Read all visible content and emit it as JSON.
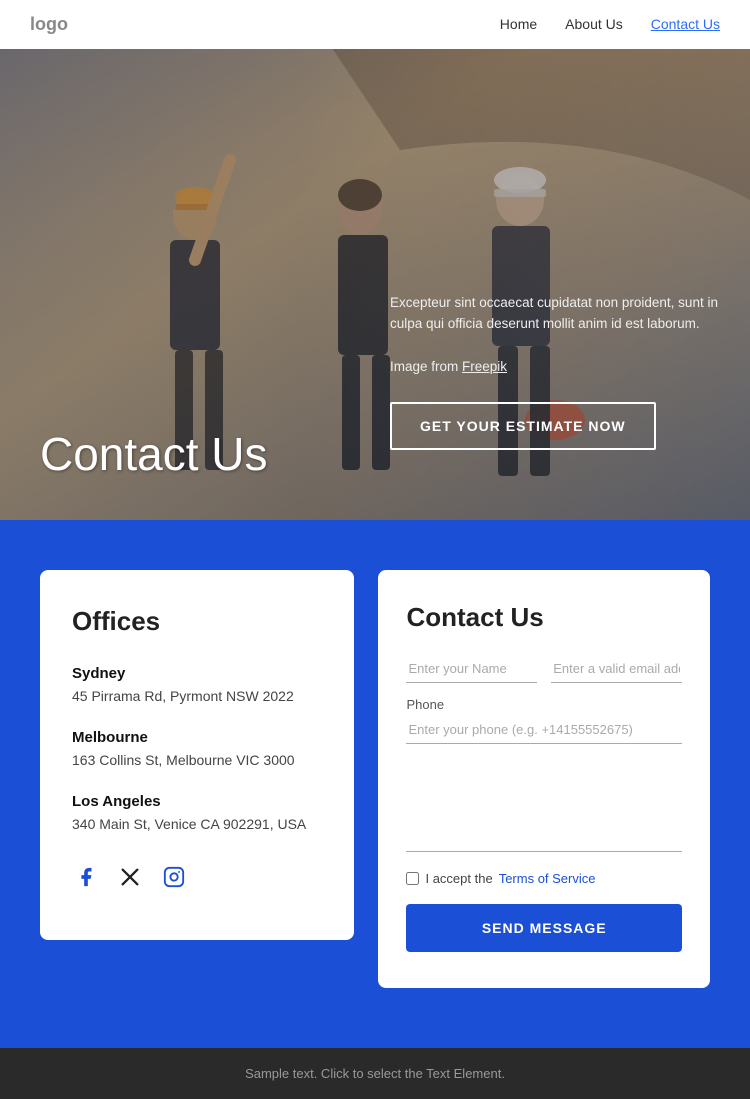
{
  "nav": {
    "logo": "logo",
    "links": [
      {
        "label": "Home",
        "active": false
      },
      {
        "label": "About Us",
        "active": false
      },
      {
        "label": "Contact Us",
        "active": true
      }
    ]
  },
  "hero": {
    "title": "Contact Us",
    "description": "Excepteur sint occaecat cupidatat non proident, sunt in culpa qui officia deserunt mollit anim id est laborum.",
    "image_credit_prefix": "Image from ",
    "image_credit_link": "Freepik",
    "cta_button": "GET YOUR ESTIMATE NOW"
  },
  "offices": {
    "title": "Offices",
    "locations": [
      {
        "city": "Sydney",
        "address": "45 Pirrama Rd, Pyrmont NSW 2022"
      },
      {
        "city": "Melbourne",
        "address": "163 Collins St, Melbourne VIC 3000"
      },
      {
        "city": "Los Angeles",
        "address": "340 Main St, Venice CA 902291, USA"
      }
    ],
    "social": [
      {
        "name": "facebook",
        "label": "Facebook"
      },
      {
        "name": "twitter-x",
        "label": "X (Twitter)"
      },
      {
        "name": "instagram",
        "label": "Instagram"
      }
    ]
  },
  "contact_form": {
    "title": "Contact Us",
    "name_placeholder": "Enter your Name",
    "email_placeholder": "Enter a valid email address",
    "phone_label": "Phone",
    "phone_placeholder": "Enter your phone (e.g. +14155552675)",
    "terms_text": "I accept the ",
    "terms_link": "Terms of Service",
    "send_button": "SEND MESSAGE"
  },
  "footer": {
    "text": "Sample text. Click to select the Text Element."
  }
}
